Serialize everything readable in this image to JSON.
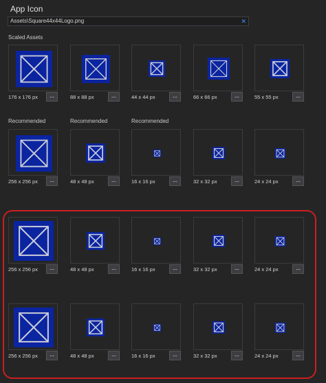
{
  "app_icon_title": "App Icon",
  "path": {
    "value": "Assets\\Square44x44Logo.png",
    "clear_label": "✕"
  },
  "scaled_assets_label": "Scaled Assets",
  "more_label": "...",
  "rows": [
    {
      "tiles": [
        {
          "size": "176 x 176 px",
          "icon": 0.8
        },
        {
          "size": "88 x 88 px",
          "icon": 0.62
        },
        {
          "size": "44 x 44 px",
          "icon": 0.36
        },
        {
          "size": "66 x 66 px",
          "icon": 0.48
        },
        {
          "size": "55 x 55 px",
          "icon": 0.42
        }
      ]
    },
    {
      "labels": [
        "Recommended",
        "Recommended",
        "Recommended"
      ],
      "tiles": [
        {
          "size": "256 x 256 px",
          "icon": 0.8
        },
        {
          "size": "48 x 48 px",
          "icon": 0.42
        },
        {
          "size": "16 x 16 px",
          "icon": 0.16
        },
        {
          "size": "32 x 32 px",
          "icon": 0.28
        },
        {
          "size": "24 x 24 px",
          "icon": 0.22
        }
      ]
    },
    {
      "tiles": [
        {
          "size": "256 x 256 px",
          "icon": 0.88
        },
        {
          "size": "48 x 48 px",
          "icon": 0.4
        },
        {
          "size": "16 x 16 px",
          "icon": 0.16
        },
        {
          "size": "32 x 32 px",
          "icon": 0.28
        },
        {
          "size": "24 x 24 px",
          "icon": 0.22
        }
      ]
    },
    {
      "tiles": [
        {
          "size": "256 x 256 px",
          "icon": 0.88
        },
        {
          "size": "48 x 48 px",
          "icon": 0.4
        },
        {
          "size": "16 x 16 px",
          "icon": 0.16
        },
        {
          "size": "32 x 32 px",
          "icon": 0.28
        },
        {
          "size": "24 x 24 px",
          "icon": 0.22
        }
      ]
    }
  ],
  "colors": {
    "icon_fill": "#0b24a0",
    "icon_stroke": "#c8ccd8",
    "highlight": "#cc1f1f"
  }
}
